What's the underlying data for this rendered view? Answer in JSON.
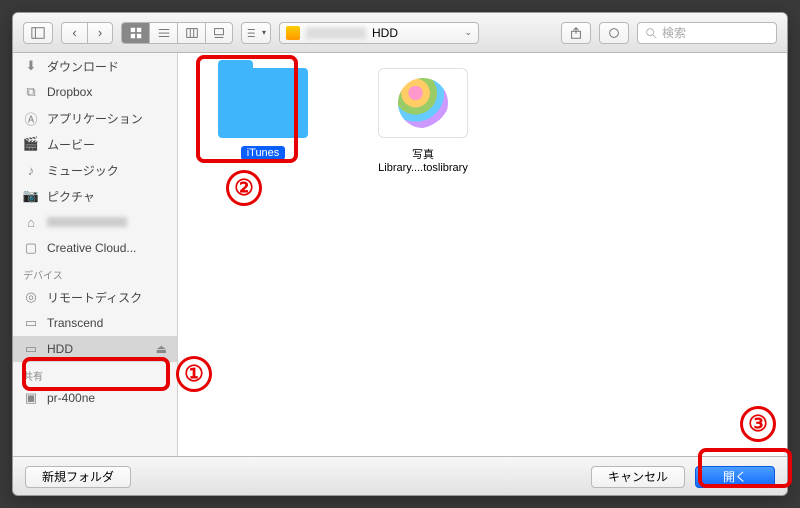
{
  "toolbar": {
    "path_drive": "HDD",
    "search_placeholder": "検索"
  },
  "sidebar": {
    "favorites": [
      {
        "icon": "download",
        "label": "ダウンロード"
      },
      {
        "icon": "dropbox",
        "label": "Dropbox"
      },
      {
        "icon": "apps",
        "label": "アプリケーション"
      },
      {
        "icon": "movie",
        "label": "ムービー"
      },
      {
        "icon": "music",
        "label": "ミュージック"
      },
      {
        "icon": "picture",
        "label": "ピクチャ"
      },
      {
        "icon": "home",
        "label": ""
      },
      {
        "icon": "folder",
        "label": "Creative Cloud..."
      }
    ],
    "devices_header": "デバイス",
    "devices": [
      {
        "icon": "disc",
        "label": "リモートディスク"
      },
      {
        "icon": "drive",
        "label": "Transcend"
      },
      {
        "icon": "drive",
        "label": "HDD",
        "selected": true
      }
    ],
    "shared_header": "共有",
    "shared": [
      {
        "icon": "net",
        "label": "pr-400ne"
      }
    ]
  },
  "files": {
    "folder_name": "iTunes",
    "photo_name_line1": "写真",
    "photo_name_line2": "Library....toslibrary"
  },
  "footer": {
    "new_folder": "新規フォルダ",
    "cancel": "キャンセル",
    "open": "開く"
  },
  "annotations": {
    "n1": "①",
    "n2": "②",
    "n3": "③"
  }
}
